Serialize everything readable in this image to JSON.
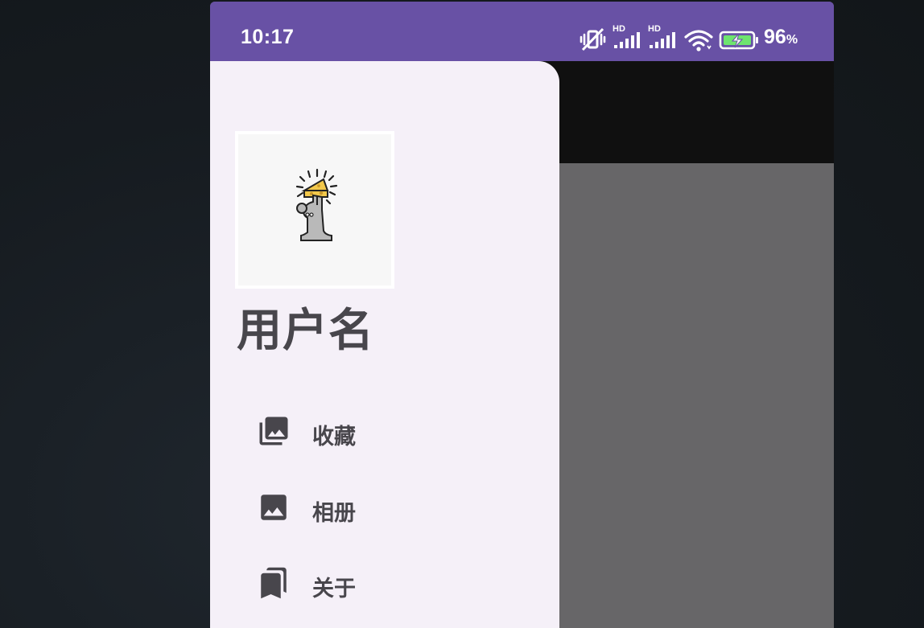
{
  "status_bar": {
    "time": "10:17",
    "signal_label_1": "HD",
    "signal_label_2": "HD",
    "battery_percent": "96",
    "battery_percent_unit": "%",
    "icons": [
      "mute-vibrate-icon",
      "signal-hd-icon",
      "signal-hd-icon",
      "wifi-icon",
      "battery-charging-icon"
    ]
  },
  "drawer": {
    "username": "用户名",
    "avatar_icon": "mouse-holding-cheese-avatar",
    "items": [
      {
        "label": "收藏",
        "icon": "photo-library-icon"
      },
      {
        "label": "相册",
        "icon": "image-icon"
      },
      {
        "label": "关于",
        "icon": "bookmarks-icon"
      }
    ]
  },
  "colors": {
    "status_bar": "#6851a5",
    "drawer_bg": "#f5f0f8",
    "text": "#48464c",
    "scrim": "#676668",
    "app_bar": "#101010"
  }
}
